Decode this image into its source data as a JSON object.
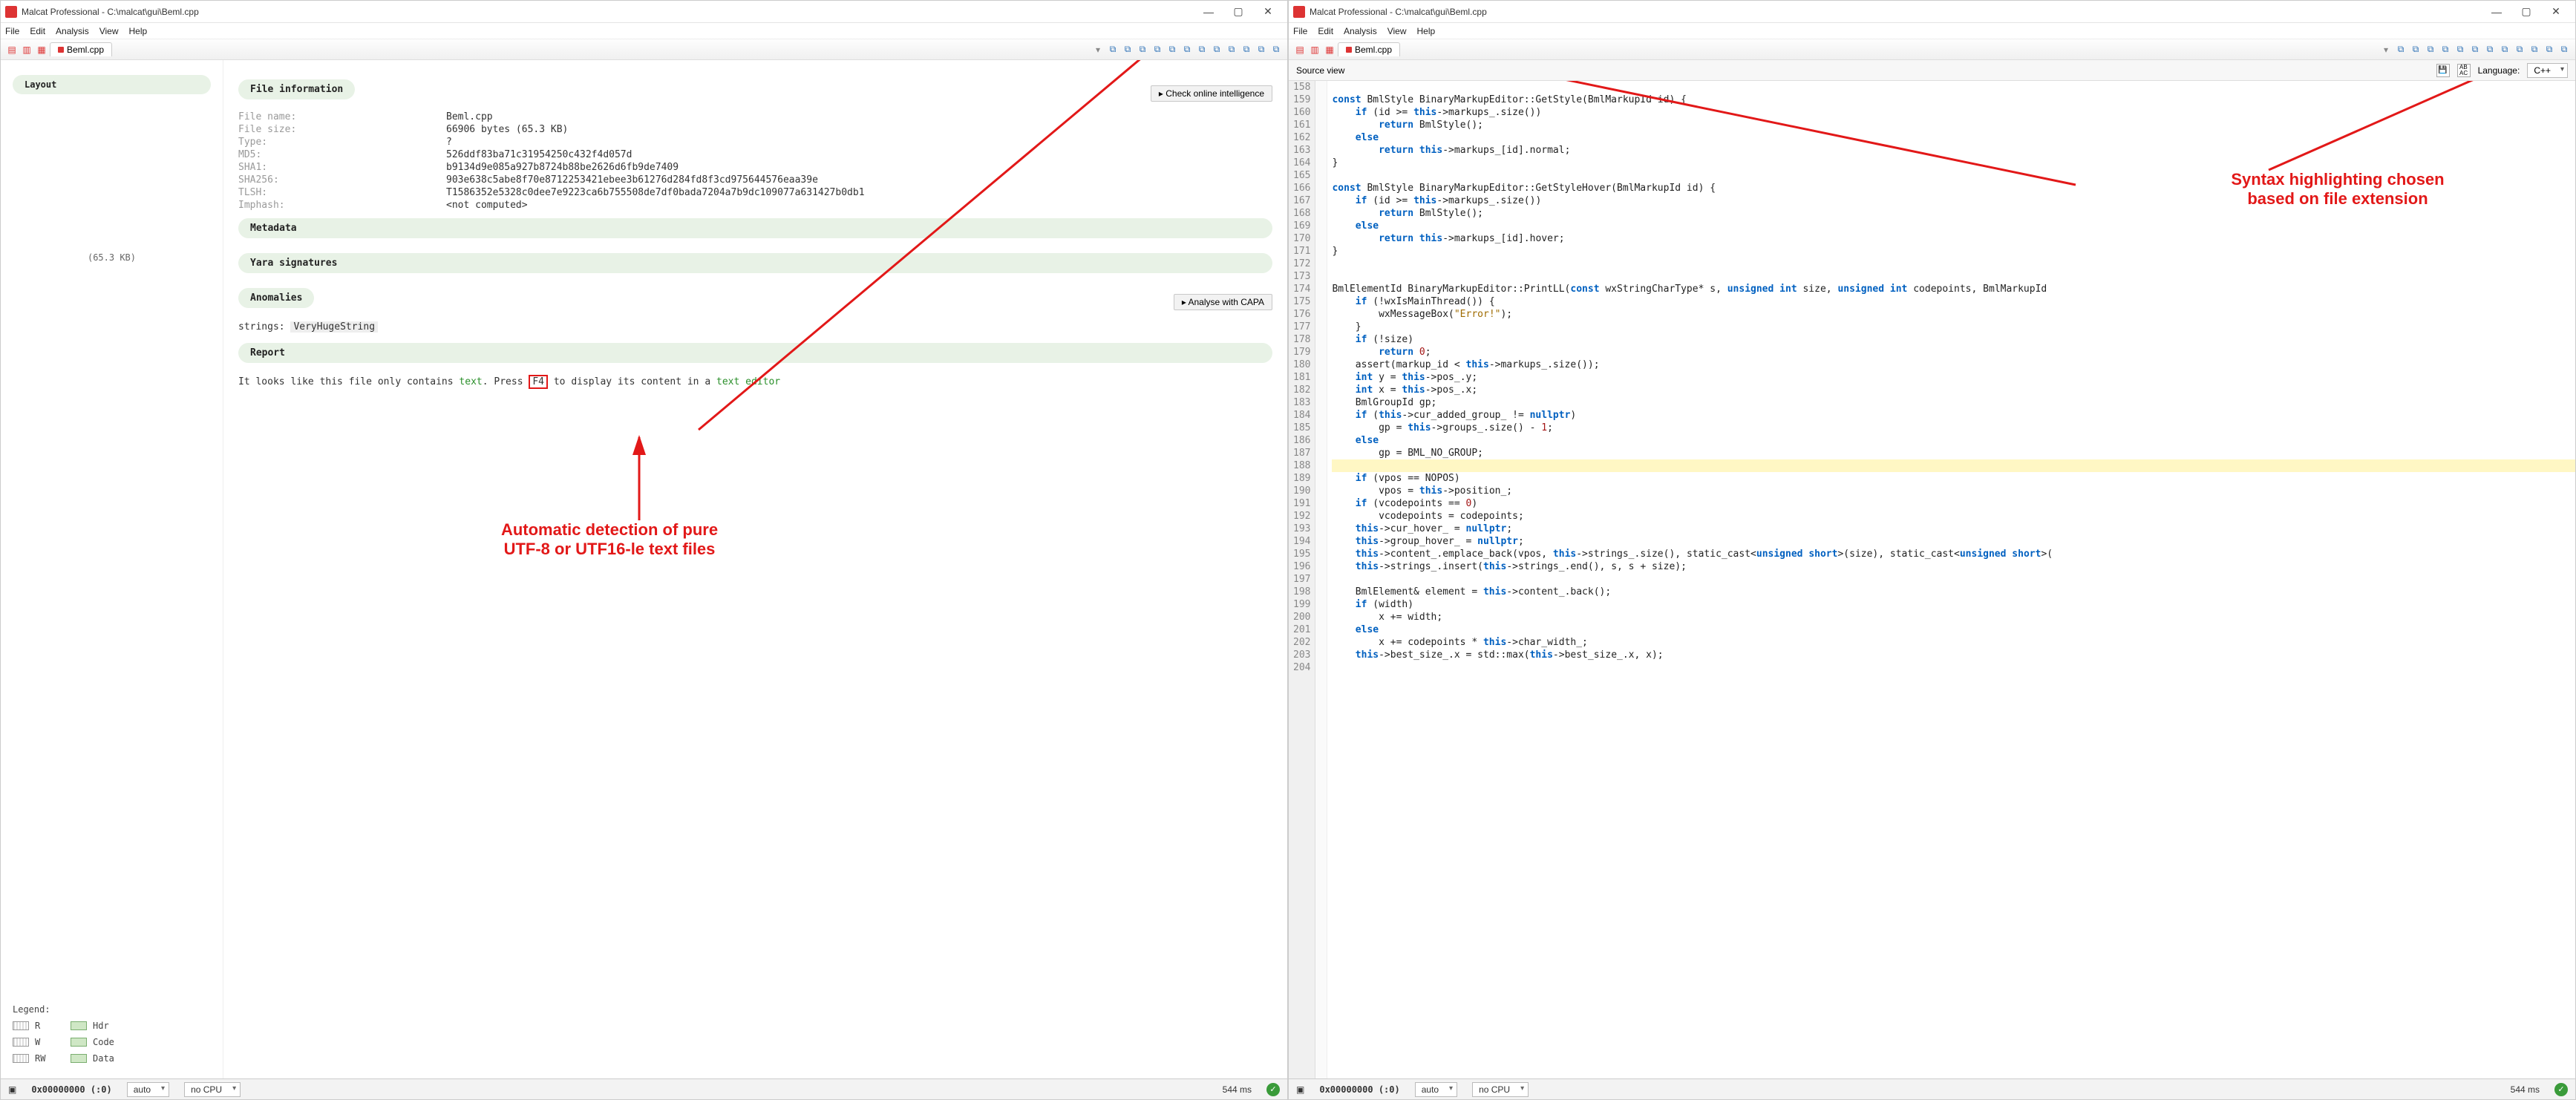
{
  "app_title": "Malcat Professional - C:\\malcat\\gui\\Beml.cpp",
  "menu": [
    "File",
    "Edit",
    "Analysis",
    "View",
    "Help"
  ],
  "tab_label": "Beml.cpp",
  "left": {
    "layout_title": "Layout",
    "size_label": "(65.3 KB)",
    "legend_title": "Legend:",
    "legend": [
      {
        "sw": "stripe",
        "t": "R"
      },
      {
        "sw": "stripe",
        "t": "W"
      },
      {
        "sw": "stripe",
        "t": "RW"
      },
      {
        "sw": "green",
        "t": "Hdr"
      },
      {
        "sw": "green",
        "t": "Code"
      },
      {
        "sw": "green",
        "t": "Data"
      }
    ]
  },
  "sections": {
    "file_info": "File information",
    "metadata": "Metadata",
    "yara": "Yara signatures",
    "anomalies": "Anomalies",
    "report": "Report"
  },
  "buttons": {
    "check_intel": "▸ Check online intelligence",
    "capa": "▸ Analyse with CAPA"
  },
  "fileinfo": [
    {
      "k": "File name:",
      "v": "Beml.cpp"
    },
    {
      "k": "File size:",
      "v": "66906 bytes (65.3 KB)"
    },
    {
      "k": "Type:",
      "v": "?"
    },
    {
      "k": "MD5:",
      "v": "526ddf83ba71c31954250c432f4d057d"
    },
    {
      "k": "SHA1:",
      "v": "b9134d9e085a927b8724b88be2626d6fb9de7409"
    },
    {
      "k": "SHA256:",
      "v": "903e638c5abe8f70e8712253421ebee3b61276d284fd8f3cd975644576eaa39e"
    },
    {
      "k": "TLSH:",
      "v": "T1586352e5328c0dee7e9223ca6b755508de7df0bada7204a7b9dc109077a631427b0db1"
    },
    {
      "k": "Imphash:",
      "v": "<not computed>"
    }
  ],
  "anomalies_line": {
    "pre": "strings: ",
    "val": "VeryHugeString"
  },
  "report_parts": {
    "pre": "It looks like this file only contains ",
    "text_word": "text",
    "mid": ". Press ",
    "f4": "F4",
    "post": " to display its content in a ",
    "te": "text editor"
  },
  "anno_left": "Automatic detection of pure\nUTF-8 or UTF16-le text files",
  "right": {
    "srcview_label": "Source view",
    "lang_label": "Language:",
    "lang_value": "C++",
    "anno": "Syntax highlighting chosen\nbased on file extension",
    "line_start": 158,
    "line_end": 204
  },
  "status": {
    "addr": "0x00000000 (:0)",
    "mode": "auto",
    "cpu": "no CPU",
    "time": "544 ms"
  }
}
